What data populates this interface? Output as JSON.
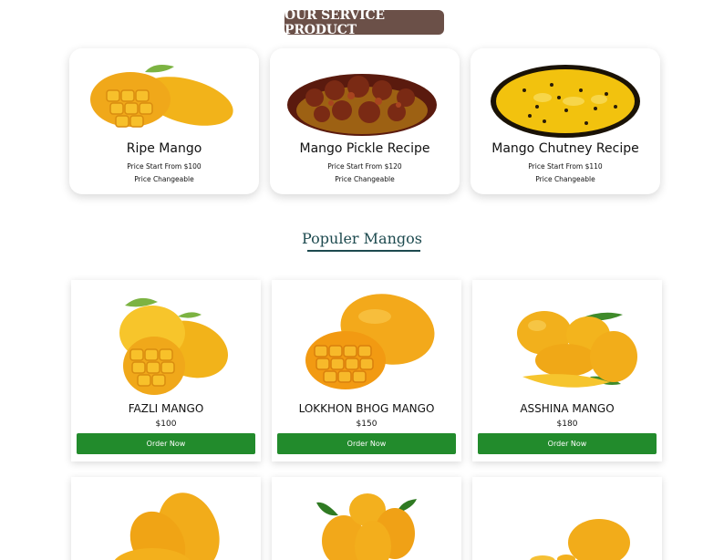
{
  "service": {
    "title": "OUR SERVICE PRODUCT",
    "cards": [
      {
        "name": "Ripe Mango",
        "price": "Price Start From $100",
        "note": "Price Changeable",
        "image": "ripe-mango-image"
      },
      {
        "name": "Mango Pickle Recipe",
        "price": "Price Start From $120",
        "note": "Price Changeable",
        "image": "mango-pickle-image"
      },
      {
        "name": "Mango Chutney Recipe",
        "price": "Price Start From $110",
        "note": "Price Changeable",
        "image": "mango-chutney-image"
      }
    ]
  },
  "popular": {
    "title": "Populer Mangos",
    "items": [
      {
        "name": "FAZLI MANGO",
        "price": "$100",
        "button": "Order Now",
        "image": "fazli-mango-image"
      },
      {
        "name": "LOKKHON BHOG MANGO",
        "price": "$150",
        "button": "Order Now",
        "image": "lokkhon-bhog-mango-image"
      },
      {
        "name": "ASSHINA MANGO",
        "price": "$180",
        "button": "Order Now",
        "image": "asshina-mango-image"
      },
      {
        "image": "mango-image"
      },
      {
        "image": "mango-bunch-image"
      },
      {
        "image": "mango-image"
      }
    ]
  },
  "colors": {
    "service_title_bg": "#6b5048",
    "popular_title": "#1d4a4f",
    "order_button": "#228b2c",
    "mango_yellow": "#f2b31a"
  }
}
